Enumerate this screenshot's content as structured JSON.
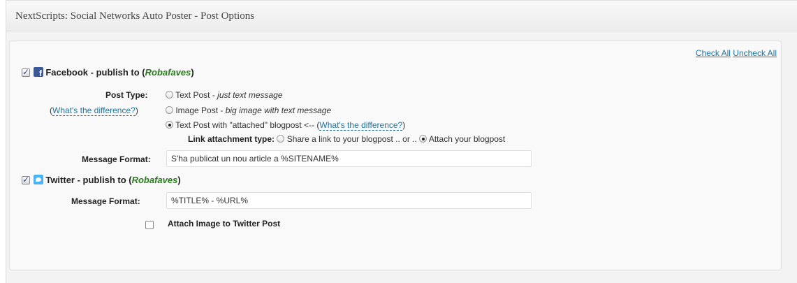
{
  "header": {
    "title": "NextScripts: Social Networks Auto Poster - Post Options"
  },
  "links": {
    "check_all": "Check All",
    "uncheck_all": "Uncheck All"
  },
  "facebook": {
    "checked": true,
    "icon": "facebook-icon",
    "title_prefix": "Facebook - publish to (",
    "account": "Robafaves",
    "title_suffix": ")",
    "post_type_label": "Post Type:",
    "diff_open": "(",
    "diff_link": "What's the difference?",
    "diff_close": ")",
    "options": [
      {
        "label": "Text Post - ",
        "desc": "just text message",
        "selected": false
      },
      {
        "label": "Image Post - ",
        "desc": "big image with text message",
        "selected": false
      },
      {
        "label": "Text Post with \"attached\" blogpost <-- (",
        "link": "What's the difference?",
        "tail": ")",
        "selected": true
      }
    ],
    "link_attachment_label": "Link attachment type:",
    "share_link": "Share a link to your blogpost .. or ..",
    "attach_blogpost": "Attach your blogpost",
    "message_format_label": "Message Format:",
    "message_format_value": "S'ha publicat un nou article a %SITENAME%"
  },
  "twitter": {
    "checked": true,
    "icon": "twitter-icon",
    "title_prefix": "Twitter - publish to (",
    "account": "Robafaves",
    "title_suffix": ")",
    "message_format_label": "Message Format:",
    "message_format_value": "%TITLE% - %URL%",
    "attach_image_label": "Attach Image to Twitter Post",
    "attach_image_checked": false
  }
}
